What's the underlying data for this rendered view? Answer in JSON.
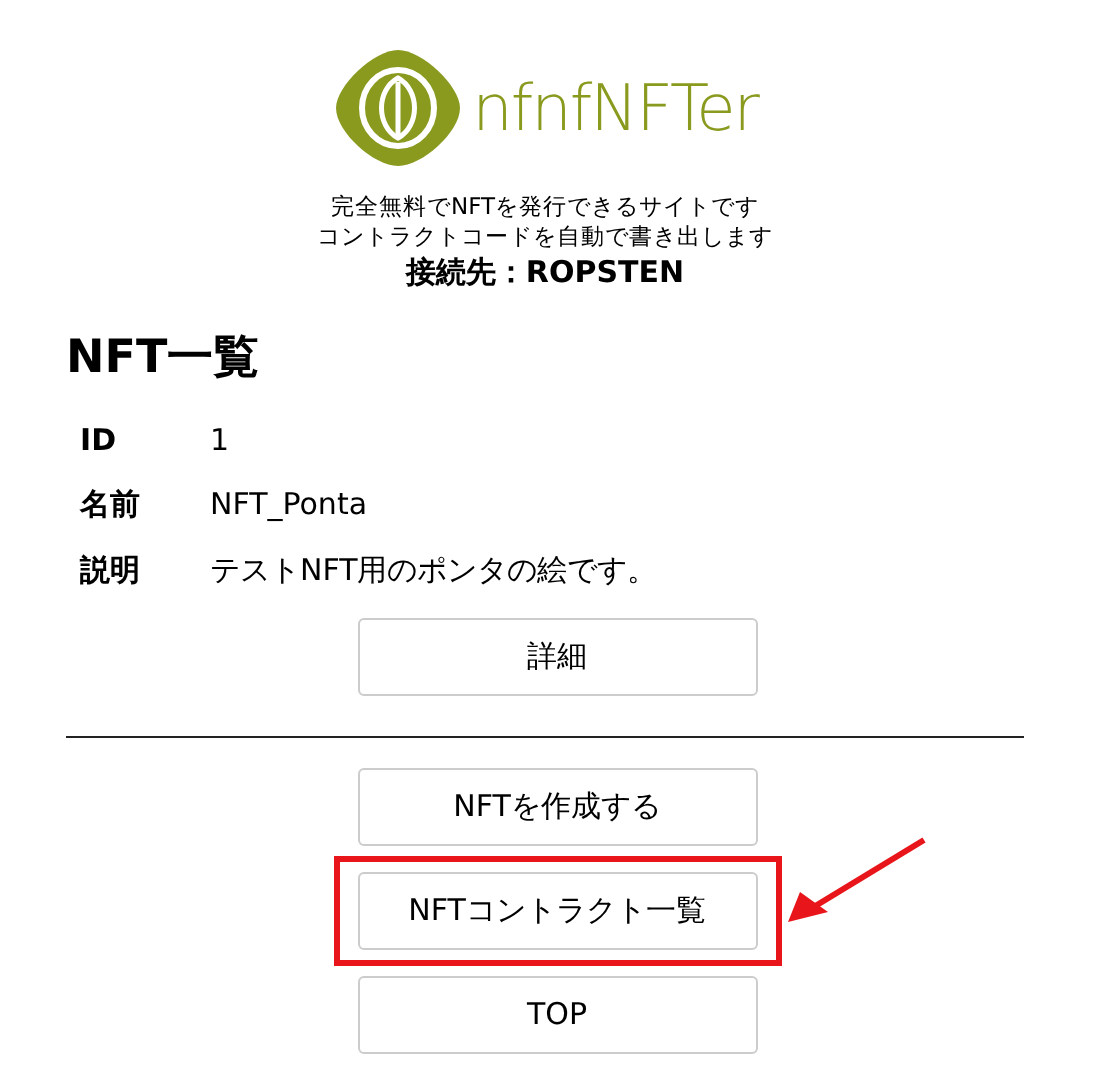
{
  "logo": {
    "text": "nfnfNFTer"
  },
  "taglines": [
    "完全無料でNFTを発行できるサイトです",
    "コントラクトコードを自動で書き出します"
  ],
  "network": "接続先：ROPSTEN",
  "heading": "NFT一覧",
  "details": [
    {
      "label": "ID",
      "value": "1"
    },
    {
      "label": "名前",
      "value": "NFT_Ponta"
    },
    {
      "label": "説明",
      "value": "テストNFT用のポンタの絵です。"
    }
  ],
  "detail_button": "詳細",
  "nav_buttons": [
    {
      "label": "NFTを作成する",
      "highlighted": false
    },
    {
      "label": "NFTコントラクト一覧",
      "highlighted": true
    },
    {
      "label": "TOP",
      "highlighted": false
    }
  ]
}
